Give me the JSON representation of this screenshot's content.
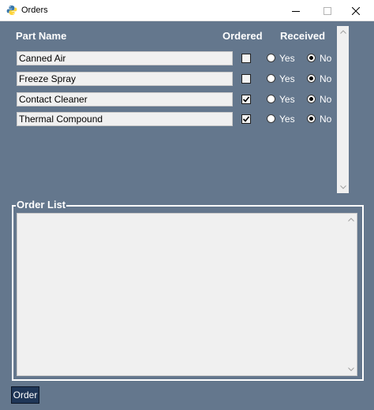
{
  "window": {
    "title": "Orders"
  },
  "headers": {
    "part_name": "Part Name",
    "ordered": "Ordered",
    "received": "Received"
  },
  "rows": [
    {
      "part": "Canned Air",
      "ordered": false,
      "received": "No"
    },
    {
      "part": "Freeze Spray",
      "ordered": false,
      "received": "No"
    },
    {
      "part": "Contact Cleaner",
      "ordered": true,
      "received": "No"
    },
    {
      "part": "Thermal Compound",
      "ordered": true,
      "received": "No"
    }
  ],
  "radio_labels": {
    "yes": "Yes",
    "no": "No"
  },
  "order_list": {
    "label": "Order List",
    "text": ""
  },
  "buttons": {
    "order": "Order"
  },
  "icons": {
    "app": "python-icon",
    "minimize": "minimize-icon",
    "maximize": "maximize-icon",
    "close": "close-icon"
  },
  "colors": {
    "background": "#64778d",
    "button": "#1f3657",
    "entry": "#f0f0f0"
  }
}
